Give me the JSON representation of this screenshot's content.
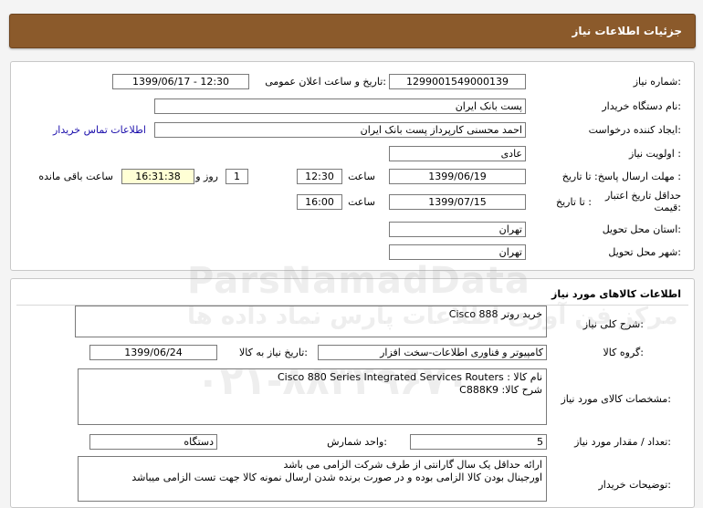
{
  "header": {
    "title": "جزئیات اطلاعات نیاز"
  },
  "details": {
    "need_number_label": "شماره نیاز:",
    "need_number": "1299001549000139",
    "announce_label": "تاریخ و ساعت اعلان عمومی:",
    "announce_value": "1399/06/17 - 12:30",
    "buyer_org_label": "نام دستگاه خریدار:",
    "buyer_org": "پست بانک ایران",
    "creator_label": "ایجاد کننده درخواست:",
    "creator": "احمد  محسنی کارپرداز پست بانک ایران",
    "contact_link": "اطلاعات تماس خریدار",
    "priority_label": "اولویت نیاز :",
    "priority": "عادی",
    "deadline_label": "مهلت ارسال پاسخ:  تا تاریخ :",
    "deadline_date": "1399/06/19",
    "time_label": "ساعت",
    "deadline_time": "12:30",
    "days_value": "1",
    "days_label": "روز و",
    "remaining_time": "16:31:38",
    "remaining_label": "ساعت باقی مانده",
    "validity_label": "حداقل تاریخ اعتبار قیمت:",
    "validity_to_label": "تا تاریخ :",
    "validity_date": "1399/07/15",
    "validity_time_label": "ساعت",
    "validity_time": "16:00",
    "province_label": "استان محل تحویل:",
    "province": "تهران",
    "city_label": "شهر محل تحویل:",
    "city": "تهران"
  },
  "goods": {
    "section_title": "اطلاعات کالاهای مورد نیاز",
    "summary_label": "شرح کلی نیاز:",
    "summary": "خرید روتر Cisco 888",
    "group_label": "گروه کالا:",
    "group": "کامپیوتر و فناوری اطلاعات-سخت افزار",
    "need_date_label": "تاریخ نیاز به کالا:",
    "need_date": "1399/06/24",
    "specs_label": "مشخصات کالای مورد نیاز:",
    "specs_line1": "نام کالا : Cisco 880 Series Integrated Services Routers",
    "specs_line2": "شرح کالا: C888K9",
    "qty_label": "تعداد / مقدار مورد نیاز:",
    "qty": "5",
    "unit_label": "واحد شمارش:",
    "unit": "دستگاه",
    "buyer_notes_label": "توضیحات خریدار:",
    "notes_line1": "ارائه حداقل یک سال گارانتی از طرف شرکت الزامی می باشد",
    "notes_line2": "اورجینال بودن کالا الزامی بوده و در صورت برنده شدن ارسال نمونه کالا جهت تست الزامی میباشد"
  },
  "watermark": {
    "brand": "ParsNamadData",
    "tagline": "مرکز فن آوری اطلاعات پارس نماد داده ها",
    "phone": "۰۲۱-۸۸۳۴۹۶۷۰"
  }
}
